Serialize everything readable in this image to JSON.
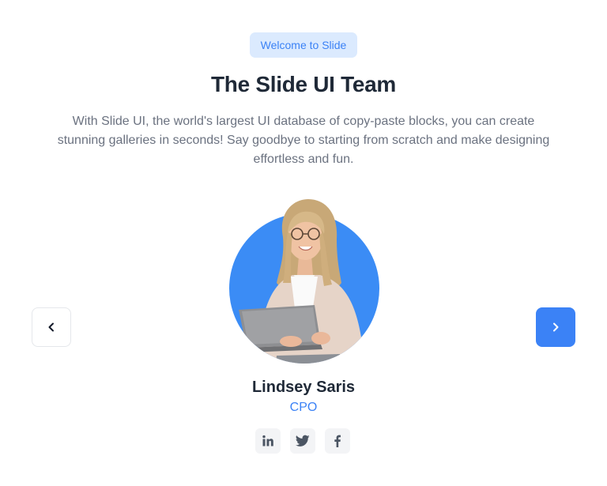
{
  "header": {
    "badge_label": "Welcome to Slide",
    "title": "The Slide UI Team",
    "description": "With Slide UI, the world's largest UI database of copy-paste blocks, you can create stunning galleries in seconds! Say goodbye to starting from scratch and make designing effortless and fun."
  },
  "carousel": {
    "prev_icon": "chevron-left-icon",
    "next_icon": "chevron-right-icon"
  },
  "member": {
    "name": "Lindsey Saris",
    "role": "CPO",
    "photo": "team-member-photo"
  },
  "socials": [
    {
      "icon": "linkedin-icon"
    },
    {
      "icon": "twitter-icon"
    },
    {
      "icon": "facebook-icon"
    }
  ],
  "colors": {
    "accent": "#3b82f6",
    "badge_bg": "#dbeafe",
    "heading": "#1f2937",
    "body_text": "#6b7280",
    "social_bg": "#f3f4f6",
    "social_icon": "#4b5563"
  }
}
